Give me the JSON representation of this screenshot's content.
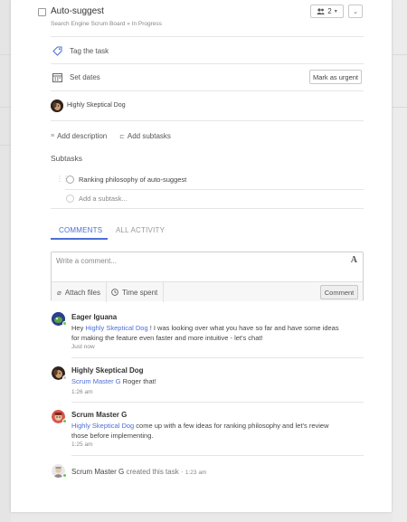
{
  "task": {
    "title": "Auto-suggest",
    "breadcrumb_board": "Search Engine Scrum Board",
    "breadcrumb_sep": "»",
    "breadcrumb_status": "In Progress",
    "followers_count": "2"
  },
  "fields": {
    "tag_label": "Tag the task",
    "dates_label": "Set dates",
    "urgent_label": "Mark as urgent",
    "assignee_name": "Highly Skeptical Dog",
    "add_description": "Add description",
    "add_subtasks": "Add subtasks"
  },
  "subtasks": {
    "heading": "Subtasks",
    "items": [
      {
        "label": "Ranking philosophy of auto-suggest"
      }
    ],
    "add_placeholder": "Add a subtask..."
  },
  "tabs": {
    "comments": "COMMENTS",
    "activity": "ALL ACTIVITY"
  },
  "composer": {
    "placeholder": "Write a comment...",
    "format_glyph": "A",
    "attach_label": "Attach files",
    "time_label": "Time spent",
    "submit_label": "Comment"
  },
  "activity": [
    {
      "author": "Eager Iguana",
      "line1_pre": "Hey ",
      "line1_mention": "Highly Skeptical Dog",
      "line1_post": " ! I was looking over what you have so far and have some ideas",
      "line2": "for making the feature even faster and more intuitive - let's chat!",
      "time": "Just now"
    },
    {
      "author": "Highly Skeptical Dog",
      "mention": "Scrum Master G",
      "text": " Roger that!",
      "time": "1:26 am"
    },
    {
      "author": "Scrum Master G",
      "mention": "Highly Skeptical Dog",
      "line1_post": " come up with a few ideas for ranking philosophy and let's review",
      "line2": "those before implementing.",
      "time": "1:25 am"
    }
  ],
  "created": {
    "author": "Scrum Master G",
    "action": "created this task",
    "sep": "·",
    "time": "1:23 am"
  },
  "colors": {
    "accent": "#4b6fd6",
    "online": "#6ac65b"
  }
}
